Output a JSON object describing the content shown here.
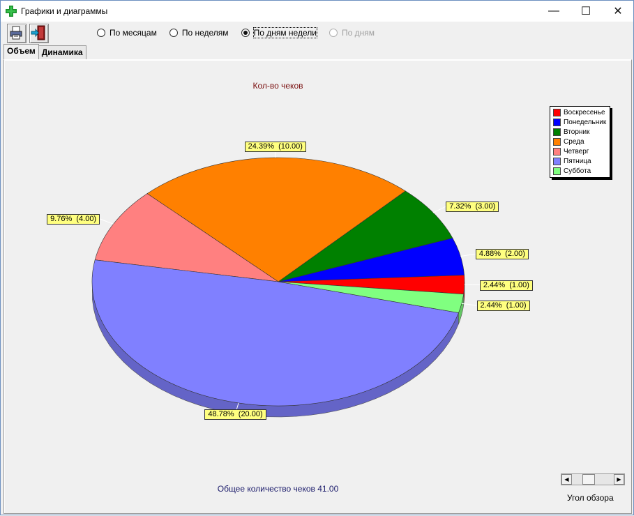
{
  "window": {
    "title": "Графики и диаграммы",
    "controls": {
      "minimize": "—",
      "maximize": "☐",
      "close": "✕"
    }
  },
  "toolbar": {
    "icons": [
      "printer-icon",
      "exit-door-icon"
    ],
    "period_options": [
      {
        "label": "По месяцам",
        "checked": false,
        "enabled": true
      },
      {
        "label": "По неделям",
        "checked": false,
        "enabled": true
      },
      {
        "label": "По дням недели",
        "checked": true,
        "enabled": true
      },
      {
        "label": "По дням",
        "checked": false,
        "enabled": false
      }
    ]
  },
  "tabs": [
    {
      "label": "Объем",
      "active": true
    },
    {
      "label": "Динамика",
      "active": false
    }
  ],
  "chart_data": {
    "type": "pie",
    "title": "Кол-во чеков",
    "categories": [
      "Воскресенье",
      "Понедельник",
      "Вторник",
      "Среда",
      "Четверг",
      "Пятница",
      "Суббота"
    ],
    "values": [
      1,
      2,
      3,
      10,
      4,
      20,
      1
    ],
    "percents": [
      2.44,
      4.88,
      7.32,
      24.39,
      9.76,
      48.78,
      2.44
    ],
    "data_labels": [
      "2.44%  (1.00)",
      "4.88%  (2.00)",
      "7.32%  (3.00)",
      "24.39%  (10.00)",
      "9.76%  (4.00)",
      "48.78%  (20.00)",
      "2.44%  (1.00)"
    ],
    "colors": [
      "#ff0000",
      "#0000ff",
      "#008000",
      "#ff8000",
      "#ff8080",
      "#8080ff",
      "#80ff80"
    ],
    "legend_position": "top-right",
    "view": "3d"
  },
  "footer": {
    "total_text": "Общее количество чеков 41.00"
  },
  "view_angle": {
    "label": "Угол обзора"
  }
}
